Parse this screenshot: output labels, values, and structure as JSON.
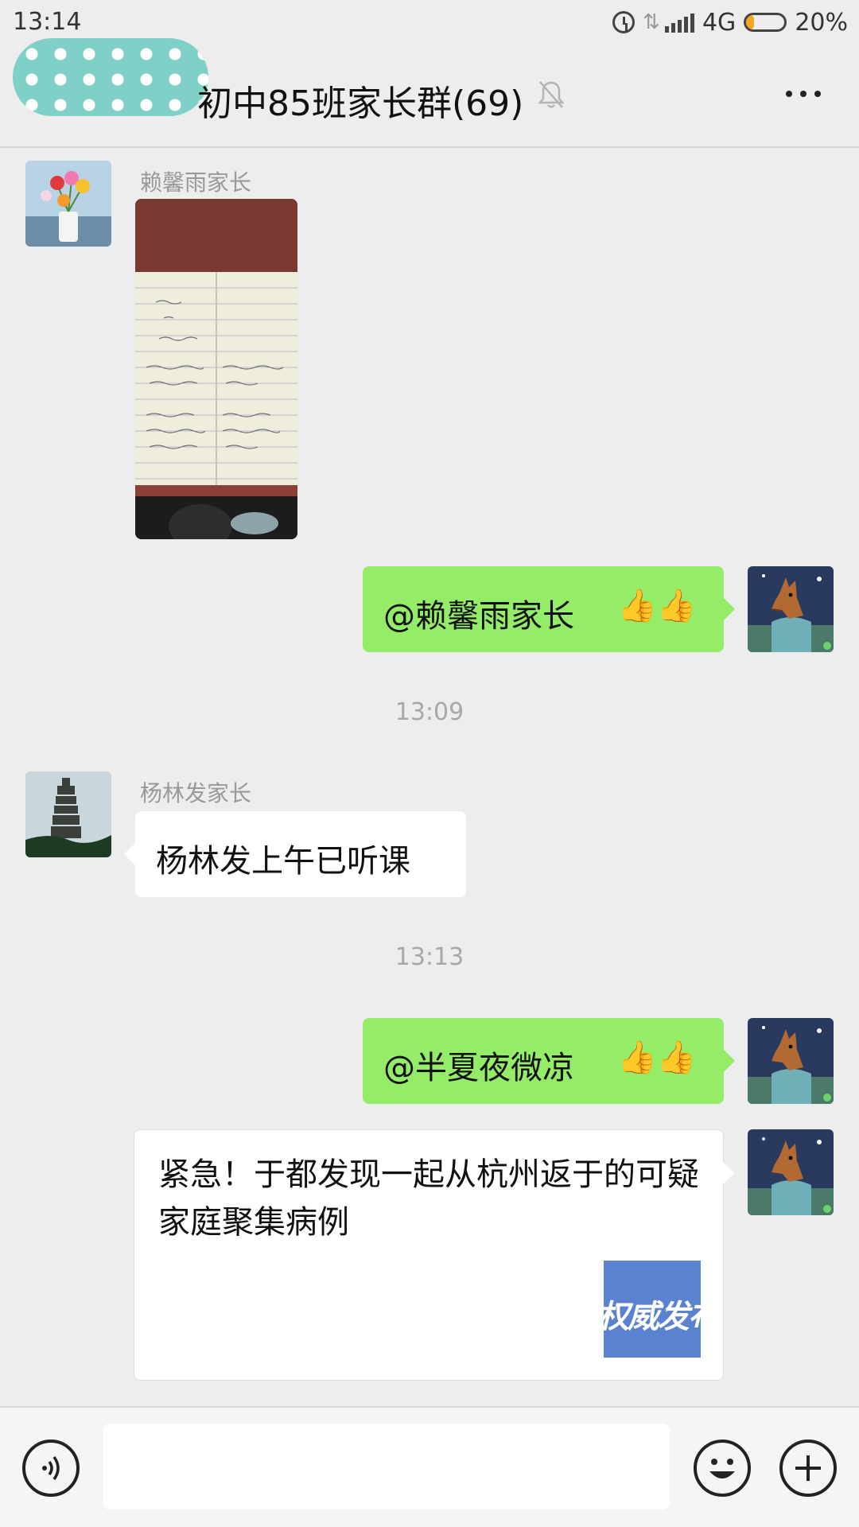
{
  "status_bar": {
    "time": "13:14",
    "network": "4G",
    "battery_text": "20%",
    "battery_level": 0.2,
    "icons": [
      "alarm-icon",
      "data-arrows-icon",
      "signal-icon",
      "battery-icon"
    ]
  },
  "header": {
    "title": "初中85班家长群(69)",
    "muted": true,
    "icons": [
      "back-icon",
      "mute-bell-icon",
      "more-icon"
    ]
  },
  "messages": [
    {
      "type": "image",
      "side": "left",
      "sender": "赖馨雨家长",
      "avatar": "flowers-vase-avatar",
      "image": "handwritten-notebook-photo"
    },
    {
      "type": "text",
      "side": "right",
      "text": "@赖馨雨家长",
      "emoji": "👍👍",
      "avatar": "horse-avatar"
    },
    {
      "type": "time",
      "text": "13:09"
    },
    {
      "type": "text",
      "side": "left",
      "sender": "杨林发家长",
      "text": "杨林发上午已听课",
      "avatar": "pagoda-avatar"
    },
    {
      "type": "time",
      "text": "13:13"
    },
    {
      "type": "text",
      "side": "right",
      "text": "@半夏夜微凉",
      "emoji": "👍👍",
      "avatar": "horse-avatar"
    },
    {
      "type": "link",
      "side": "right",
      "title": "紧急！于都发现一起从杭州返于的可疑家庭聚集病例",
      "thumb_text": "权威发布",
      "avatar": "horse-avatar"
    }
  ],
  "input_bar": {
    "value": "",
    "icons": [
      "voice-icon",
      "emoji-icon",
      "plus-icon"
    ]
  },
  "colors": {
    "background": "#ededed",
    "my_bubble": "#95ec69",
    "other_bubble": "#ffffff",
    "back_blob": "#7fd1c7",
    "battery_fill": "#f4a623",
    "link_thumb": "#5b82cf"
  }
}
